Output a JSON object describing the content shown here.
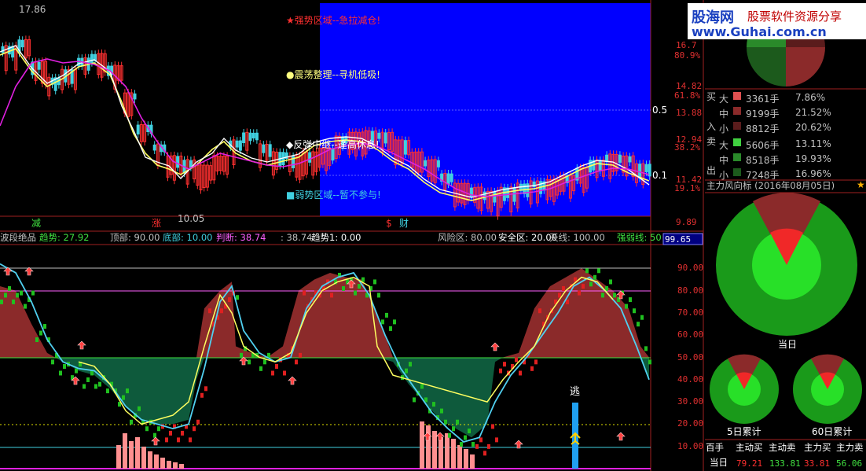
{
  "colors": {
    "background": "#000000",
    "chart_blue": "#0000ff",
    "rise_red": "#ff3030",
    "fall_green": "#00c000",
    "cyan": "#40d0e0",
    "yellow": "#ffff40",
    "magenta": "#e020e0",
    "area_red": "#8b2a2a",
    "area_green": "#0e5a3c",
    "pink_bar": "#ff9090",
    "axis_red": "#e03030"
  },
  "upper_chart": {
    "high_price_label": "17.86",
    "low_price_label": "10.05",
    "zone_notes": [
      {
        "text": "★强势区域--急拉减仓!",
        "color": "#ff3030"
      },
      {
        "text": "●震荡整理--寻机低吸!",
        "color": "#ffff80"
      },
      {
        "text": "◆反弹中继--逢高休息!",
        "color": "#ffffff"
      },
      {
        "text": "■弱势区域--暂不参与!",
        "color": "#40d0e0"
      }
    ],
    "bottom_markers": [
      {
        "text": "减",
        "color": "#40e040"
      },
      {
        "text": "涨",
        "color": "#ff3030"
      },
      {
        "text": "$",
        "color": "#ff3030"
      },
      {
        "text": "财",
        "color": "#40d0e0"
      }
    ],
    "level_labels": [
      "0.5",
      "0.1"
    ],
    "right_axis": {
      "prices": [
        "16.7",
        "14.82",
        "13.88",
        "12.94",
        "11.42",
        "9.89"
      ],
      "percents": [
        "80.9%",
        "61.8%",
        "38.2%",
        "19.1%"
      ]
    }
  },
  "indicator_header": {
    "name": "波段绝品",
    "items": [
      {
        "label": "趋势: 27.92",
        "color": "#40e040"
      },
      {
        "label": "顶部: 90.00",
        "color": "#c0c0c0"
      },
      {
        "label": "底部: 10.00",
        "color": "#40d0e0"
      },
      {
        "label": "判断: 38.74",
        "color": "#ff60ff"
      },
      {
        "label": ": 38.74",
        "color": "#c0c0c0"
      },
      {
        "label": "趋势1: 0.00",
        "color": "#ffffff"
      },
      {
        "label": "风险区: 80.00",
        "color": "#c0c0c0"
      },
      {
        "label": "安全区: 20.00",
        "color": "#ffffff"
      },
      {
        "label": "天线: 100.00",
        "color": "#c0c0c0"
      },
      {
        "label": "强弱线: 50",
        "color": "#40e040"
      }
    ],
    "current_value": "99.65"
  },
  "indicator_axis": [
    "90.00",
    "80.00",
    "70.00",
    "60.00",
    "50.00",
    "40.00",
    "30.00",
    "20.00",
    "10.00"
  ],
  "escape_label": "逃",
  "watermark": {
    "brand": "股海网",
    "slogan": "股票软件资源分享",
    "url": "www.Guhai.com.cn"
  },
  "flow_table": {
    "buy_label": "买",
    "in_label": "入",
    "sell_label": "卖",
    "out_label": "出",
    "rows": [
      {
        "side": "big",
        "size": "大",
        "qty": "3361手",
        "pct": "7.86%",
        "color": "#e05050"
      },
      {
        "side": "mid",
        "size": "中",
        "qty": "9199手",
        "pct": "21.52%",
        "color": "#8b2a2a"
      },
      {
        "side": "small",
        "size": "小",
        "qty": "8812手",
        "pct": "20.62%",
        "color": "#5a1c1c"
      },
      {
        "side": "big",
        "size": "大",
        "qty": "5606手",
        "pct": "13.11%",
        "color": "#40d040"
      },
      {
        "side": "mid",
        "size": "中",
        "qty": "8518手",
        "pct": "19.93%",
        "color": "#2a8a2a"
      },
      {
        "side": "small",
        "size": "小",
        "qty": "7248手",
        "pct": "16.96%",
        "color": "#1c5a1c"
      }
    ]
  },
  "gauge_panel": {
    "title": "主力风向标 (2016年08月05日)",
    "big_label": "当日",
    "left_label": "5日累计",
    "right_label": "60日累计"
  },
  "bottom_table": {
    "headers": [
      "百手",
      "主动买",
      "主动卖",
      "主力买",
      "主力卖"
    ],
    "row_label": "当日",
    "values": [
      "79.21",
      "133.81",
      "33.81",
      "56.06"
    ],
    "value_colors": [
      "#ff3030",
      "#40e040",
      "#ff3030",
      "#40e040"
    ]
  }
}
